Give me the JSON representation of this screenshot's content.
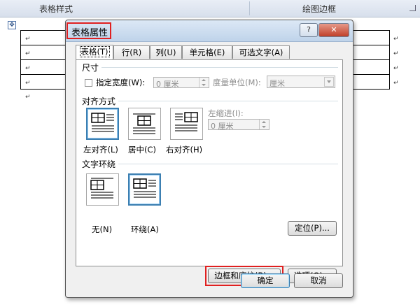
{
  "ribbon": {
    "left_group": "表格样式",
    "right_group": "绘图边框"
  },
  "doc": {
    "para_mark": "↵",
    "move_handle": "✥"
  },
  "dialog": {
    "title": "表格属性",
    "help_label": "?",
    "close_label": "✕",
    "tabs": [
      {
        "label": "表格(T)",
        "active": true
      },
      {
        "label": "行(R)"
      },
      {
        "label": "列(U)"
      },
      {
        "label": "单元格(E)"
      },
      {
        "label": "可选文字(A)"
      }
    ],
    "size": {
      "section": "尺寸",
      "preferred_width_label": "指定宽度(W):",
      "preferred_width_value": "0 厘米",
      "unit_label": "度量单位(M):",
      "unit_value": "厘米"
    },
    "alignment": {
      "section": "对齐方式",
      "options": [
        "左对齐(L)",
        "居中(C)",
        "右对齐(H)"
      ],
      "selected": "左对齐(L)",
      "indent_label": "左缩进(I):",
      "indent_value": "0 厘米"
    },
    "wrapping": {
      "section": "文字环绕",
      "options": [
        "无(N)",
        "环绕(A)"
      ],
      "selected": "环绕(A)",
      "positioning_button": "定位(P)..."
    },
    "borders_button": "边框和底纹(B)...",
    "options_button": "选项(O)...",
    "ok_button": "确定",
    "cancel_button": "取消"
  }
}
